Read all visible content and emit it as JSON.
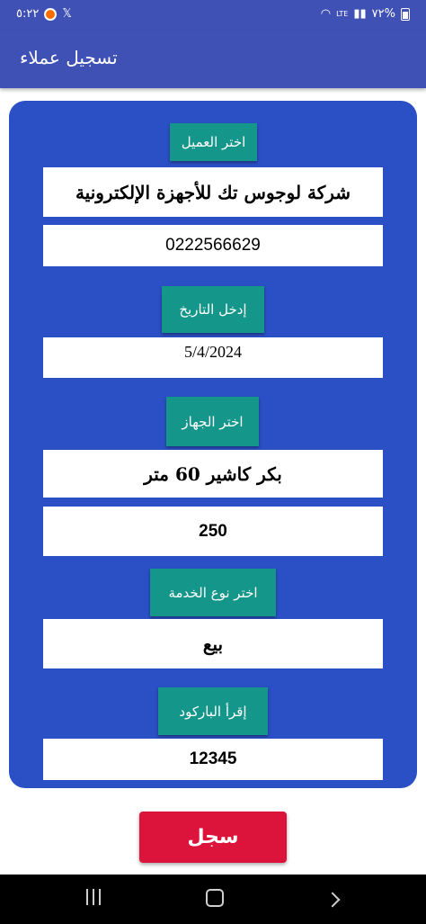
{
  "status_bar": {
    "time": "٥:٢٢",
    "battery": "%٧٢",
    "network": "LTE"
  },
  "app_bar": {
    "title": "تسجيل عملاء"
  },
  "form": {
    "customer_button": "اختر العميل",
    "customer_name": "شركة لوجوس تك للأجهزة الإلكترونية",
    "customer_phone": "0222566629",
    "date_button": "إدخل التاريخ",
    "date_value": "5/4/2024",
    "device_button": "اختر الجهاز",
    "device_name": "بكر كاشير 60 متر",
    "device_price": "250",
    "service_button": "اختر نوع الخدمة",
    "service_value": "بيع",
    "barcode_button": "إقرأ الباركود",
    "barcode_value": "12345"
  },
  "actions": {
    "save_label": "سجل"
  },
  "colors": {
    "primary": "#3f51b5",
    "card": "#2b4fc4",
    "teal": "#15968a",
    "save": "#dc143c"
  }
}
